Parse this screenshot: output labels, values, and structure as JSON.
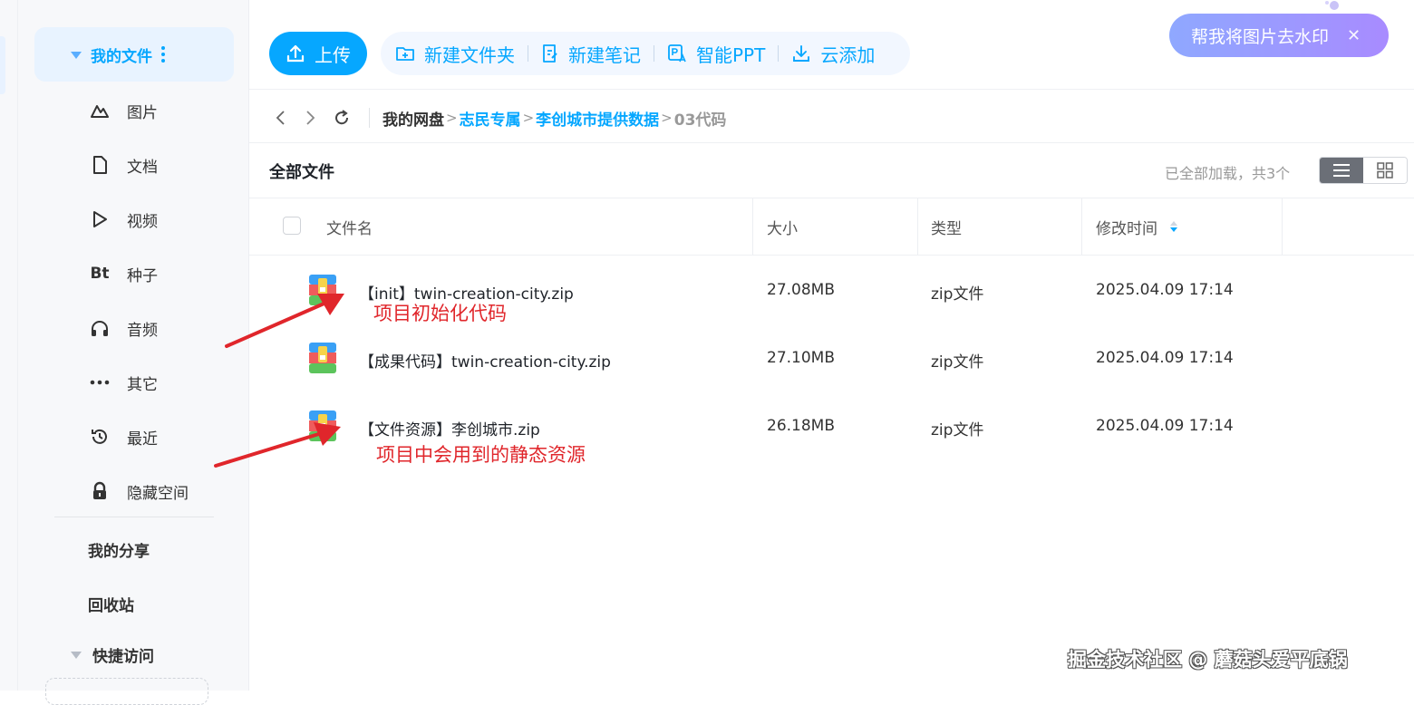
{
  "sidebar": {
    "my_files": "我的文件",
    "items": [
      {
        "label": "图片",
        "icon": "image-icon"
      },
      {
        "label": "文档",
        "icon": "document-icon"
      },
      {
        "label": "视频",
        "icon": "video-icon"
      },
      {
        "label": "种子",
        "icon": "bt-icon",
        "icon_text": "Bt"
      },
      {
        "label": "音频",
        "icon": "headphones-icon"
      },
      {
        "label": "其它",
        "icon": "more-icon"
      },
      {
        "label": "最近",
        "icon": "history-icon"
      },
      {
        "label": "隐藏空间",
        "icon": "lock-icon"
      }
    ],
    "my_share": "我的分享",
    "recycle": "回收站",
    "quick_access": "快捷访问"
  },
  "toolbar": {
    "upload": "上传",
    "new_folder": "新建文件夹",
    "new_note": "新建笔记",
    "smart_ppt": "智能PPT",
    "cloud_add": "云添加"
  },
  "watermark_button": "帮我将图片去水印",
  "breadcrumb": {
    "root": "我的网盘",
    "level1": "志民专属",
    "level2": "李创城市提供数据",
    "current": "03代码"
  },
  "list_header": {
    "title": "全部文件",
    "status": "已全部加载，共3个"
  },
  "table": {
    "columns": [
      "文件名",
      "大小",
      "类型",
      "修改时间"
    ],
    "rows": [
      {
        "name": "【init】twin-creation-city.zip",
        "size": "27.08MB",
        "type": "zip文件",
        "modified": "2025.04.09 17:14"
      },
      {
        "name": "【成果代码】twin-creation-city.zip",
        "size": "27.10MB",
        "type": "zip文件",
        "modified": "2025.04.09 17:14"
      },
      {
        "name": "【文件资源】李创城市.zip",
        "size": "26.18MB",
        "type": "zip文件",
        "modified": "2025.04.09 17:14"
      }
    ]
  },
  "annotations": {
    "init": "项目初始化代码",
    "resources": "项目中会用到的静态资源"
  },
  "credit": "掘金技术社区 @ 蘑菇头爱平底锅",
  "colors": {
    "accent": "#06a7ff",
    "annotation": "#e0262b",
    "sidebar_bg": "#f7f8fa"
  }
}
